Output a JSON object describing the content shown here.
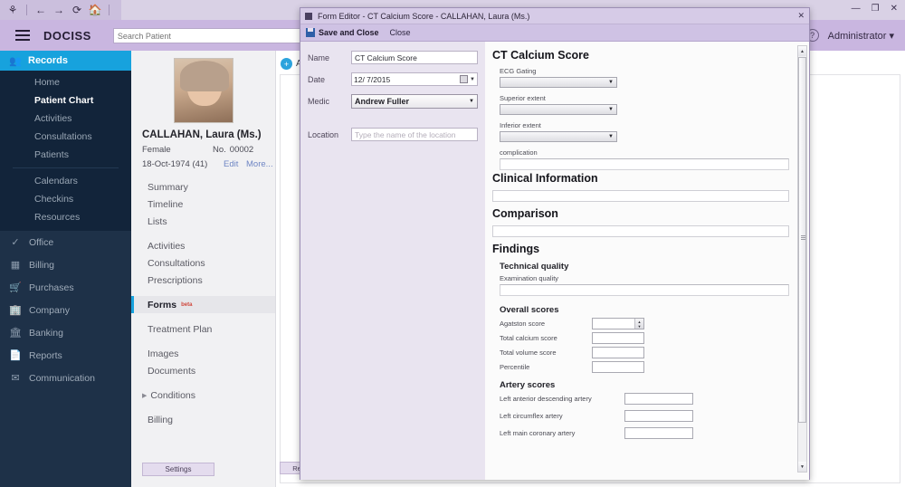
{
  "browser": {
    "icons": [
      "app-icon",
      "back-arrow-icon",
      "forward-arrow-icon",
      "refresh-icon",
      "home-icon"
    ]
  },
  "header": {
    "brand": "DOCISS",
    "menu_icon": "hamburger-icon",
    "search_placeholder": "Search Patient",
    "search_value": "",
    "help_icon": "question-mark-icon",
    "account": "Administrator ▾",
    "window_controls": [
      "—",
      "❐",
      "✕"
    ]
  },
  "sidebar": {
    "active": {
      "label": "Records",
      "icon": "people-icon"
    },
    "sub_items": [
      {
        "label": "Home",
        "current": false
      },
      {
        "label": "Patient Chart",
        "current": true
      },
      {
        "label": "Activities",
        "current": false
      },
      {
        "label": "Consultations",
        "current": false
      },
      {
        "label": "Patients",
        "current": false
      }
    ],
    "sub_items_2": [
      {
        "label": "Calendars"
      },
      {
        "label": "Checkins"
      },
      {
        "label": "Resources"
      }
    ],
    "main_items": [
      {
        "label": "Office",
        "icon": "check-circle-icon"
      },
      {
        "label": "Billing",
        "icon": "calculator-icon"
      },
      {
        "label": "Purchases",
        "icon": "cart-icon"
      },
      {
        "label": "Company",
        "icon": "building-icon"
      },
      {
        "label": "Banking",
        "icon": "bank-icon"
      },
      {
        "label": "Reports",
        "icon": "document-icon"
      },
      {
        "label": "Communication",
        "icon": "envelope-icon"
      }
    ]
  },
  "patient": {
    "avatar": "patient-photo",
    "name": "CALLAHAN, Laura (Ms.)",
    "gender": "Female",
    "number_label": "No.",
    "number": "00002",
    "dob": "18-Oct-1974 (41)",
    "edit_link": "Edit",
    "more_link": "More...",
    "nav_group1": [
      "Summary",
      "Timeline",
      "Lists"
    ],
    "nav_group2": [
      "Activities",
      "Consultations",
      "Prescriptions"
    ],
    "nav_forms": {
      "label": "Forms",
      "badge": "beta"
    },
    "nav_group3": [
      "Treatment Plan"
    ],
    "nav_group4": [
      "Images",
      "Documents"
    ],
    "nav_conditions": "Conditions",
    "nav_group5": [
      "Billing"
    ],
    "settings_button": "Settings"
  },
  "content": {
    "add_label": "A",
    "add_icon": "plus-circle-icon",
    "resource_button": "Reso"
  },
  "modal": {
    "title": "Form Editor - CT Calcium Score - CALLAHAN, Laura (Ms.)",
    "title_icon": "window-icon",
    "close_icon": "✕",
    "save_button": "Save and Close",
    "save_icon": "save-disk-icon",
    "close_button": "Close",
    "left_panel": {
      "name_label": "Name",
      "name_value": "CT Calcium Score",
      "date_label": "Date",
      "date_value": "12/  7/2015",
      "medic_label": "Medic",
      "medic_value": "Andrew Fuller",
      "location_label": "Location",
      "location_placeholder": "Type the name of the location",
      "location_value": ""
    },
    "form": {
      "heading": "CT Calcium Score",
      "ecg_gating_label": "ECG Gating",
      "ecg_gating_value": "",
      "superior_extent_label": "Superior extent",
      "superior_extent_value": "",
      "inferior_extent_label": "Inferior extent",
      "inferior_extent_value": "",
      "complication_label": "complication",
      "complication_value": "",
      "clinical_information_heading": "Clinical Information",
      "clinical_information_value": "",
      "comparison_heading": "Comparison",
      "comparison_value": "",
      "findings_heading": "Findings",
      "technical_quality_heading": "Technical quality",
      "examination_quality_label": "Examination quality",
      "examination_quality_value": "",
      "overall_scores_heading": "Overall scores",
      "agatston_label": "Agatston score",
      "agatston_value": "",
      "total_calcium_label": "Total calcium score",
      "total_calcium_value": "",
      "total_volume_label": "Total volume score",
      "total_volume_value": "",
      "percentile_label": "Percentile",
      "percentile_value": "",
      "artery_scores_heading": "Artery scores",
      "lad_label": "Left anterior descending artery",
      "lad_value": "",
      "lcx_label": "Left circumflex artery",
      "lcx_value": "",
      "lmca_label": "Left main coronary artery",
      "lmca_value": ""
    }
  },
  "colors": {
    "accent_blue": "#17a2dd",
    "sidebar_dark": "#1e3148",
    "header_purple": "#c9b6e0",
    "modal_title": "#d6cbe7"
  }
}
